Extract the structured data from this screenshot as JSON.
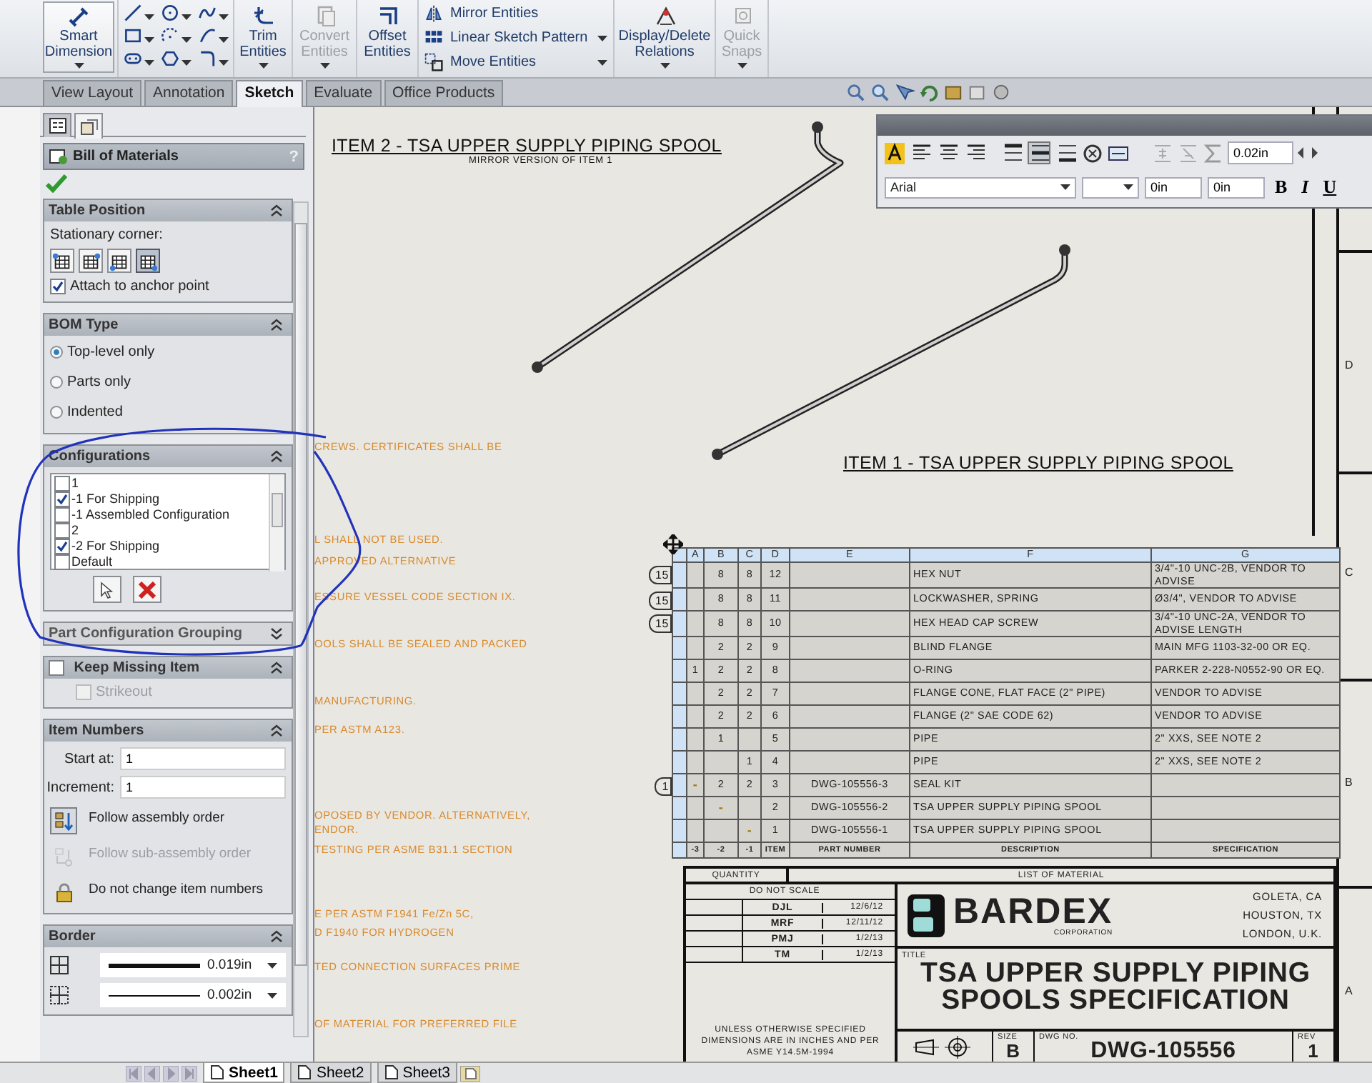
{
  "ribbon": [
    {
      "kind": "large",
      "label": "Smart Dimension",
      "disabled": false,
      "selected": true,
      "dropdown": true
    },
    {
      "kind": "icons"
    },
    {
      "kind": "large",
      "label": "Trim Entities",
      "disabled": false,
      "selected": false,
      "dropdown": true
    },
    {
      "kind": "large",
      "label": "Convert Entities",
      "disabled": true,
      "selected": false,
      "dropdown": true
    },
    {
      "kind": "large",
      "label": "Offset Entities",
      "disabled": false,
      "selected": false,
      "dropdown": false
    },
    {
      "kind": "list",
      "items": [
        {
          "label": "Mirror Entities",
          "dropdown": false
        },
        {
          "label": "Linear Sketch Pattern",
          "dropdown": true
        },
        {
          "label": "Move Entities",
          "dropdown": true
        }
      ]
    },
    {
      "kind": "large",
      "label": "Display/Delete Relations",
      "disabled": false,
      "selected": false,
      "dropdown": true
    },
    {
      "kind": "large",
      "label": "Quick Snaps",
      "disabled": true,
      "selected": false,
      "dropdown": true
    }
  ],
  "tabs": [
    {
      "label": "View Layout",
      "selected": false
    },
    {
      "label": "Annotation",
      "selected": false
    },
    {
      "label": "Sketch",
      "selected": true
    },
    {
      "label": "Evaluate",
      "selected": false
    },
    {
      "label": "Office Products",
      "selected": false
    }
  ],
  "panel": {
    "tabs": [
      {
        "selected": false
      },
      {
        "selected": true
      }
    ],
    "title": "Bill of Materials",
    "help": "?",
    "sections": [
      {
        "kind": "table_position",
        "title": "Table Position",
        "expanded": true,
        "label": "Stationary corner:",
        "corners": [
          {
            "selected": false
          },
          {
            "selected": false
          },
          {
            "selected": false
          },
          {
            "selected": true
          }
        ],
        "checkbox": {
          "label": "Attach to anchor point",
          "checked": true
        }
      },
      {
        "kind": "radios",
        "title": "BOM Type",
        "expanded": true,
        "options": [
          {
            "label": "Top-level only",
            "selected": true
          },
          {
            "label": "Parts only",
            "selected": false
          },
          {
            "label": "Indented",
            "selected": false
          }
        ]
      },
      {
        "kind": "checklist",
        "title": "Configurations",
        "expanded": true,
        "items": [
          {
            "label": "1",
            "checked": false
          },
          {
            "label": "-1 For Shipping",
            "checked": true
          },
          {
            "label": "-1 Assembled Configuration",
            "checked": false
          },
          {
            "label": "2",
            "checked": false
          },
          {
            "label": "-2 For Shipping",
            "checked": true
          },
          {
            "label": "Default",
            "checked": false
          }
        ]
      },
      {
        "kind": "collapsed",
        "title": "Part Configuration Grouping",
        "expanded": false
      },
      {
        "kind": "check_header",
        "title": "Keep Missing Item",
        "checked": false,
        "expanded": true,
        "option": {
          "label": "Strikeout",
          "checked": false,
          "disabled": true
        }
      },
      {
        "kind": "item_numbers",
        "title": "Item Numbers",
        "expanded": true,
        "fields": [
          {
            "label": "Start at:",
            "value": "1"
          },
          {
            "label": "Increment:",
            "value": "1"
          }
        ],
        "options": [
          {
            "label": "Follow assembly order",
            "selected": true,
            "disabled": false
          },
          {
            "label": "Follow sub-assembly order",
            "selected": false,
            "disabled": true
          },
          {
            "label": "Do not change item numbers",
            "selected": false,
            "disabled": false
          }
        ]
      },
      {
        "kind": "border",
        "title": "Border",
        "expanded": true,
        "lines": [
          {
            "kind": "thick",
            "value": "0.019in"
          },
          {
            "kind": "thin",
            "value": "0.002in"
          }
        ]
      }
    ]
  },
  "drawing": {
    "labels": [
      {
        "kind": "heading",
        "text": "ITEM 2 - TSA UPPER SUPPLY PIPING SPOOL"
      },
      {
        "kind": "subheading",
        "text": "MIRROR VERSION OF ITEM 1"
      },
      {
        "kind": "heading",
        "text": "ITEM 1 - TSA UPPER SUPPLY PIPING SPOOL"
      }
    ],
    "notes": [
      "CREWS.  CERTIFICATES SHALL BE",
      "L SHALL NOT BE USED.",
      "APPROVED ALTERNATIVE",
      "ESSURE VESSEL CODE SECTION IX.",
      "OOLS SHALL BE SEALED AND PACKED",
      "MANUFACTURING.",
      "PER ASTM A123.",
      "OPOSED BY VENDOR. ALTERNATIVELY,",
      "ENDOR.",
      "TESTING PER ASME B31.1 SECTION",
      "E PER ASTM F1941 Fe/Zn 5C,",
      "D F1940 FOR HYDROGEN",
      "TED CONNECTION SURFACES PRIME",
      "OF MATERIAL FOR PREFERRED FILE"
    ],
    "zones": [
      "D",
      "C",
      "B",
      "A"
    ],
    "bom": {
      "columns": [
        "A",
        "B",
        "C",
        "D",
        "E",
        "F",
        "G"
      ],
      "rows": [
        {
          "balloon": "15",
          "cells": [
            null,
            "8",
            "8",
            "12",
            null,
            "HEX NUT",
            "3/4\"-10 UNC-2B, VENDOR TO ADVISE"
          ]
        },
        {
          "balloon": "15",
          "cells": [
            null,
            "8",
            "8",
            "11",
            null,
            "LOCKWASHER, SPRING",
            "Ø3/4\", VENDOR TO ADVISE"
          ]
        },
        {
          "balloon": "15",
          "cells": [
            null,
            "8",
            "8",
            "10",
            null,
            "HEX HEAD CAP SCREW",
            "3/4\"-10 UNC-2A, VENDOR TO ADVISE LENGTH"
          ]
        },
        {
          "cells": [
            null,
            "2",
            "2",
            "9",
            null,
            "BLIND FLANGE",
            "MAIN MFG 1103-32-00 OR EQ."
          ]
        },
        {
          "cells": [
            "1",
            "2",
            "2",
            "8",
            null,
            "O-RING",
            "PARKER 2-228-N0552-90 OR EQ."
          ]
        },
        {
          "cells": [
            null,
            "2",
            "2",
            "7",
            null,
            "FLANGE CONE, FLAT FACE (2\" PIPE)",
            "VENDOR TO ADVISE"
          ]
        },
        {
          "cells": [
            null,
            "2",
            "2",
            "6",
            null,
            "FLANGE (2\" SAE CODE 62)",
            "VENDOR TO ADVISE"
          ]
        },
        {
          "cells": [
            null,
            "1",
            null,
            "5",
            null,
            "PIPE",
            "2\" XXS, SEE NOTE 2"
          ]
        },
        {
          "cells": [
            null,
            null,
            "1",
            "4",
            null,
            "PIPE",
            "2\" XXS, SEE NOTE 2"
          ]
        },
        {
          "balloon": "1",
          "cells": [
            {
              "kind": "marker",
              "text": "-"
            },
            "2",
            "2",
            "3",
            "DWG-105556-3",
            "SEAL KIT",
            null
          ]
        },
        {
          "cells": [
            null,
            {
              "kind": "marker",
              "text": "-"
            },
            null,
            "2",
            "DWG-105556-2",
            "TSA UPPER SUPPLY PIPING SPOOL",
            null
          ]
        },
        {
          "cells": [
            null,
            null,
            {
              "kind": "marker",
              "text": "-"
            },
            "1",
            "DWG-105556-1",
            "TSA UPPER SUPPLY PIPING SPOOL",
            null
          ]
        }
      ],
      "footer": [
        "-3",
        "-2",
        "-1",
        "ITEM",
        "PART NUMBER",
        "DESCRIPTION",
        "SPECIFICATION"
      ]
    },
    "title_block": {
      "caption": [
        "QUANTITY",
        "LIST OF MATERIAL"
      ],
      "scale_note": "DO NOT SCALE",
      "signoffs": [
        {
          "name": "DJL",
          "date": "12/6/12"
        },
        {
          "name": "MRF",
          "date": "12/11/12"
        },
        {
          "name": "PMJ",
          "date": "1/2/13"
        },
        {
          "name": "TM",
          "date": "1/2/13"
        }
      ],
      "tolerance_note": "UNLESS OTHERWISE SPECIFIED DIMENSIONS ARE IN INCHES AND PER ASME Y14.5M-1994",
      "company": "BARDEX",
      "company_sub": "CORPORATION",
      "locations": [
        "GOLETA, CA",
        "HOUSTON, TX",
        "LONDON, U.K."
      ],
      "title_label": "TITLE",
      "title": "TSA UPPER SUPPLY PIPING SPOOLS SPECIFICATION",
      "size_label": "SIZE",
      "size": "B",
      "dwg_label": "DWG NO.",
      "dwg": "DWG-105556",
      "rev_label": "REV",
      "rev": "1"
    }
  },
  "format_toolbar": {
    "halign": [
      {
        "selected": false
      },
      {
        "selected": false
      },
      {
        "selected": false
      }
    ],
    "valign": [
      {
        "selected": false
      },
      {
        "selected": true
      },
      {
        "selected": false
      }
    ],
    "spacing": "0.02in",
    "font": "Arial",
    "indents": [
      "0in",
      "0in"
    ],
    "styles": [
      "B",
      "I",
      "U"
    ]
  },
  "sheet_tabs": [
    {
      "label": "Sheet1",
      "selected": true
    },
    {
      "label": "Sheet2",
      "selected": false
    },
    {
      "label": "Sheet3",
      "selected": false
    }
  ]
}
